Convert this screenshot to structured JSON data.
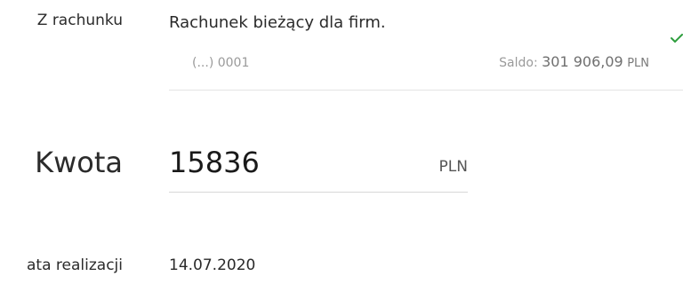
{
  "account": {
    "label": "Z rachunku",
    "name": "Rachunek bieżący dla firm.",
    "number": "(...) 0001",
    "balance_label": "Saldo:",
    "balance_value": "301 906,09",
    "balance_currency": "PLN",
    "check_color": "#2e9e3e"
  },
  "amount": {
    "label": "Kwota",
    "value": "15836",
    "currency": "PLN"
  },
  "date": {
    "label": "ata realizacji",
    "value": "14.07.2020"
  }
}
